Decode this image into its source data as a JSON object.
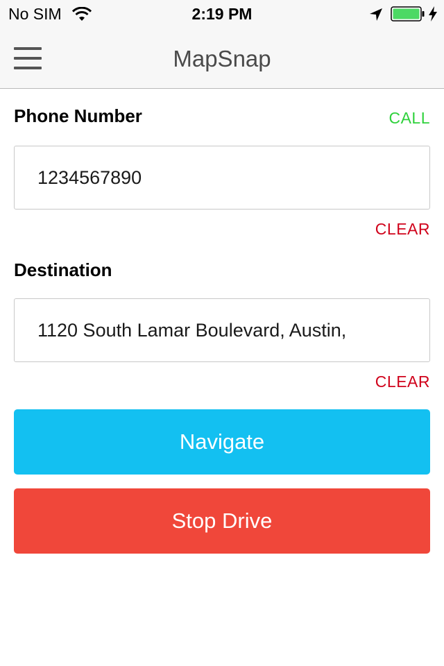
{
  "status_bar": {
    "carrier": "No SIM",
    "time": "2:19 PM",
    "battery_color": "#4cd964",
    "icons": [
      "wifi-icon",
      "location-arrow-icon",
      "battery-icon",
      "charging-bolt-icon"
    ]
  },
  "nav": {
    "title": "MapSnap",
    "menu_icon": "hamburger-menu-icon"
  },
  "form": {
    "phone": {
      "label": "Phone Number",
      "call_label": "CALL",
      "value": "1234567890",
      "clear_label": "CLEAR"
    },
    "destination": {
      "label": "Destination",
      "value": "1120 South Lamar Boulevard, Austin,",
      "clear_label": "CLEAR"
    }
  },
  "buttons": {
    "navigate_label": "Navigate",
    "stop_label": "Stop Drive"
  },
  "colors": {
    "call": "#2fd13c",
    "clear": "#d0021b",
    "navigate": "#13c0f1",
    "stop": "#f0473a"
  }
}
